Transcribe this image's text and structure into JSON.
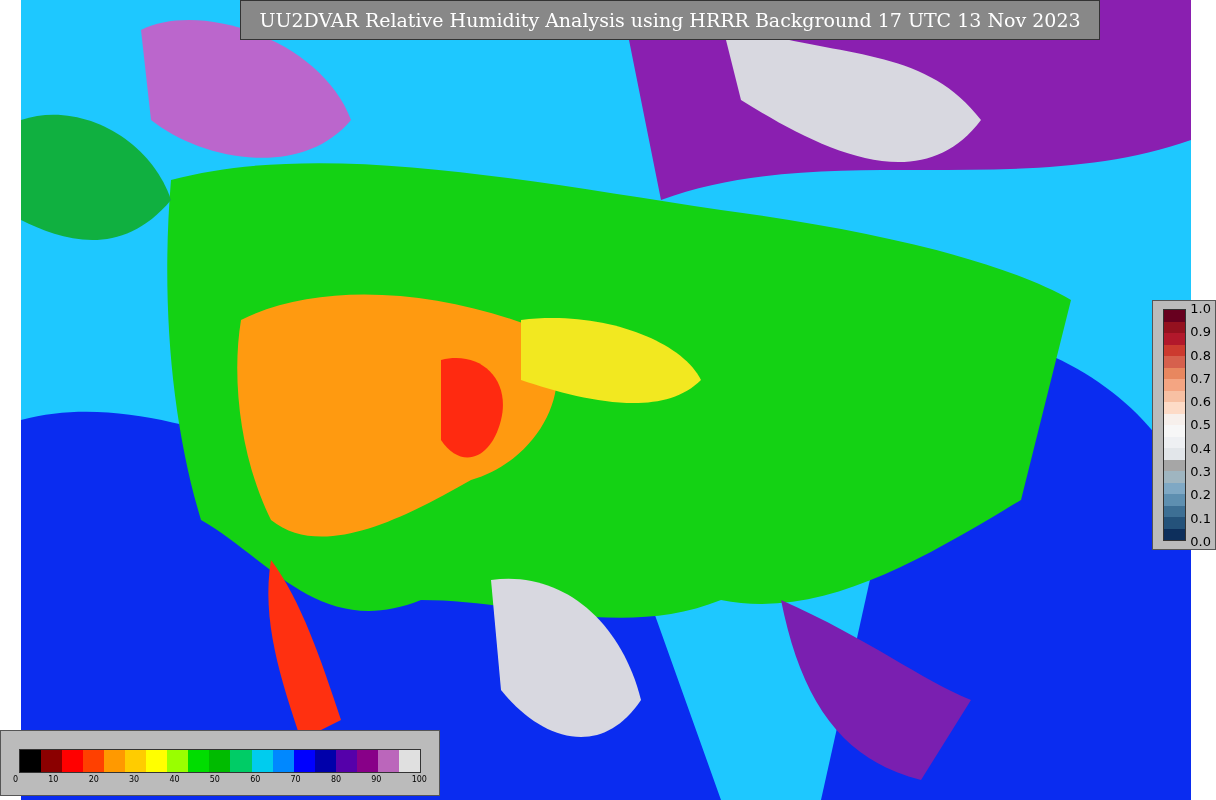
{
  "title": "UU2DVAR Relative Humidity Analysis using HRRR Background 17 UTC 13 Nov 2023",
  "station_scale": {
    "ticks": [
      "1.0",
      "0.9",
      "0.8",
      "0.7",
      "0.6",
      "0.5",
      "0.4",
      "0.3",
      "0.2",
      "0.1",
      "0.0"
    ],
    "bands": [
      {
        "color": "#67001f"
      },
      {
        "color": "#94111f"
      },
      {
        "color": "#b2182b"
      },
      {
        "color": "#cc3a2f"
      },
      {
        "color": "#d6604d"
      },
      {
        "color": "#e8875f"
      },
      {
        "color": "#f4a582"
      },
      {
        "color": "#f7c0a3"
      },
      {
        "color": "#fddbc7"
      },
      {
        "color": "#f7f0ec"
      },
      {
        "color": "#f7f7f7"
      },
      {
        "color": "#eef0f3"
      },
      {
        "color": "#e2e6ea"
      },
      {
        "color": "#a6a6a6"
      },
      {
        "color": "#9fb5c0"
      },
      {
        "color": "#7fa8c4"
      },
      {
        "color": "#5e8fb0"
      },
      {
        "color": "#3d6f94"
      },
      {
        "color": "#24527a"
      },
      {
        "color": "#0d2f5c"
      }
    ]
  },
  "humidity_scale": {
    "ticks": [
      "0",
      "10",
      "20",
      "30",
      "40",
      "50",
      "60",
      "70",
      "80",
      "90",
      "100"
    ],
    "bands": [
      {
        "color": "#000000"
      },
      {
        "color": "#8b0000"
      },
      {
        "color": "#ff0000"
      },
      {
        "color": "#ff4000"
      },
      {
        "color": "#ff9900"
      },
      {
        "color": "#ffcc00"
      },
      {
        "color": "#ffff00"
      },
      {
        "color": "#99ff00"
      },
      {
        "color": "#00dd00"
      },
      {
        "color": "#00bb00"
      },
      {
        "color": "#00cc66"
      },
      {
        "color": "#00ccee"
      },
      {
        "color": "#0088ff"
      },
      {
        "color": "#0000ff"
      },
      {
        "color": "#0000aa"
      },
      {
        "color": "#5500aa"
      },
      {
        "color": "#880088"
      },
      {
        "color": "#bb66bb"
      },
      {
        "color": "#e0e0e0"
      }
    ]
  }
}
